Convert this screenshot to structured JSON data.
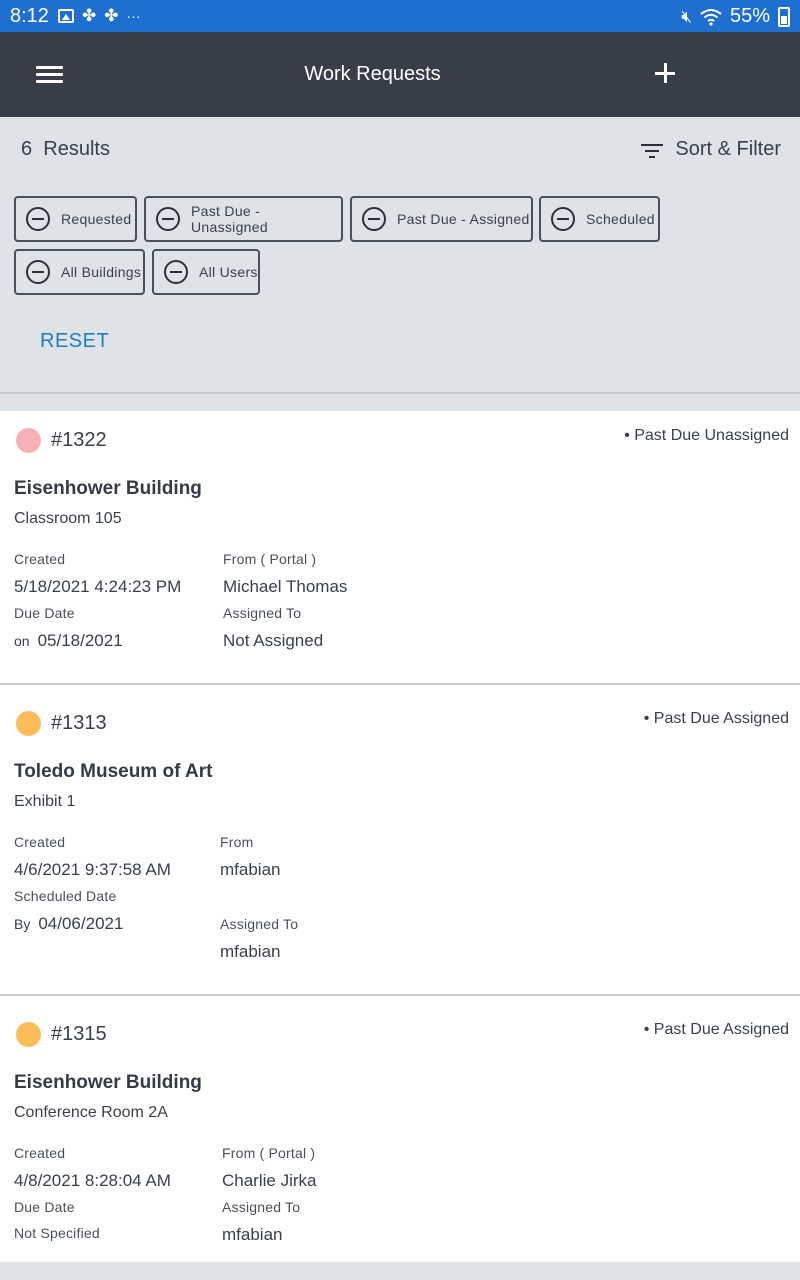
{
  "status_bar": {
    "time": "8:12",
    "icons_left": [
      "image-icon",
      "pinwheel-icon",
      "pinwheel-icon",
      "more-dots-icon"
    ],
    "battery": "55%",
    "icons_right": [
      "mute-icon",
      "wifi-icon",
      "battery-icon"
    ]
  },
  "appbar": {
    "title": "Work Requests",
    "menu_icon": "hamburger-icon",
    "add_icon": "plus-icon"
  },
  "filters": {
    "results_count": "6",
    "results_label": "Results",
    "sort_filter_label": "Sort & Filter",
    "chips": [
      {
        "label": "Requested"
      },
      {
        "label": "Past Due - Unassigned"
      },
      {
        "label": "Past Due - Assigned"
      },
      {
        "label": "Scheduled"
      },
      {
        "label": "All Buildings"
      },
      {
        "label": "All Users"
      }
    ],
    "reset_label": "RESET"
  },
  "colors": {
    "status_bar": "#1f6fd1",
    "app_bar": "#383e47",
    "panel_bg": "#dde3e6",
    "reset_link": "#1c7fc2",
    "dot_unassigned": "#f6b1b4",
    "dot_assigned": "#fbbd5a"
  },
  "requests": [
    {
      "id": "#1322",
      "status": "• Past Due Unassigned",
      "building": "Eisenhower Building",
      "room": "Classroom 105",
      "created_label": "Created",
      "created": "5/18/2021 4:24:23 PM",
      "from_label": "From ( Portal )",
      "from": "Michael Thomas",
      "date_label": "Due Date",
      "date_prefix": "on",
      "date": "05/18/2021",
      "assigned_label": "Assigned To",
      "assigned": "Not Assigned"
    },
    {
      "id": "#1313",
      "status": "• Past Due Assigned",
      "building": "Toledo Museum of Art",
      "room": "Exhibit 1",
      "created_label": "Created",
      "created": "4/6/2021 9:37:58 AM",
      "from_label": "From",
      "from": "mfabian",
      "date_label": "Scheduled Date",
      "date_prefix": "By",
      "date": "04/06/2021",
      "assigned_label": "Assigned To",
      "assigned": "mfabian"
    },
    {
      "id": "#1315",
      "status": "• Past Due Assigned",
      "building": "Eisenhower Building",
      "room": "Conference Room 2A",
      "created_label": "Created",
      "created": "4/8/2021 8:28:04 AM",
      "from_label": "From ( Portal )",
      "from": "Charlie Jirka",
      "date_label": "Due Date",
      "date_value": "Not Specified",
      "assigned_label": "Assigned To",
      "assigned": "mfabian"
    }
  ]
}
